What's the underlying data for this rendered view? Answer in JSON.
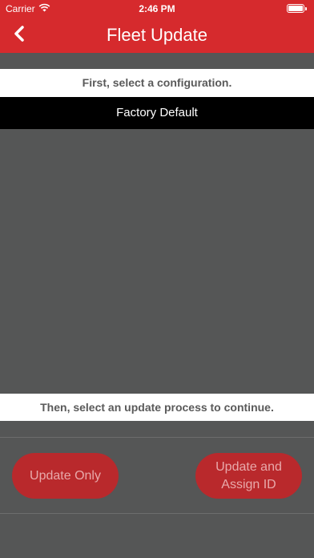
{
  "status_bar": {
    "carrier": "Carrier",
    "time": "2:46 PM",
    "wifi_icon": "wifi-icon",
    "battery_icon": "battery-icon"
  },
  "nav": {
    "back_icon": "chevron-left-icon",
    "title": "Fleet Update"
  },
  "main": {
    "config_prompt": "First, select a configuration.",
    "configurations": [
      "Factory Default"
    ],
    "process_prompt": "Then, select an update process to continue."
  },
  "actions": {
    "update_only": "Update Only",
    "update_and_assign": "Update and Assign ID"
  },
  "colors": {
    "accent": "#d62a2d",
    "background": "#555656",
    "button": "#b9292c",
    "button_text": "#e8a9aa"
  }
}
